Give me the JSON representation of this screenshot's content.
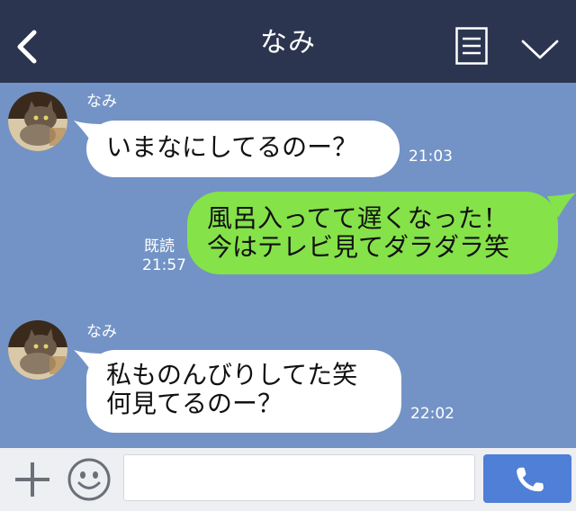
{
  "header": {
    "title": "なみ",
    "bg_color": "#2b3550"
  },
  "chat": {
    "bg_color": "#7393c6",
    "messages": [
      {
        "sender": "なみ",
        "text": "いまなにしてるのー？",
        "time": "21:03",
        "direction": "incoming"
      },
      {
        "text": "風呂入ってて遅くなった！\n今はテレビ見てダラダラ笑",
        "read_label": "既読",
        "time": "21:57",
        "direction": "outgoing"
      },
      {
        "sender": "なみ",
        "text": "私ものんびりしてた笑\n何見てるのー？",
        "time": "22:02",
        "direction": "incoming"
      }
    ]
  },
  "footer": {
    "input_value": "",
    "accent_color": "#4f7fd7"
  },
  "icons": [
    "back-chevron-icon",
    "menu-list-icon",
    "chevron-down-icon",
    "plus-icon",
    "smiley-icon",
    "phone-icon"
  ]
}
